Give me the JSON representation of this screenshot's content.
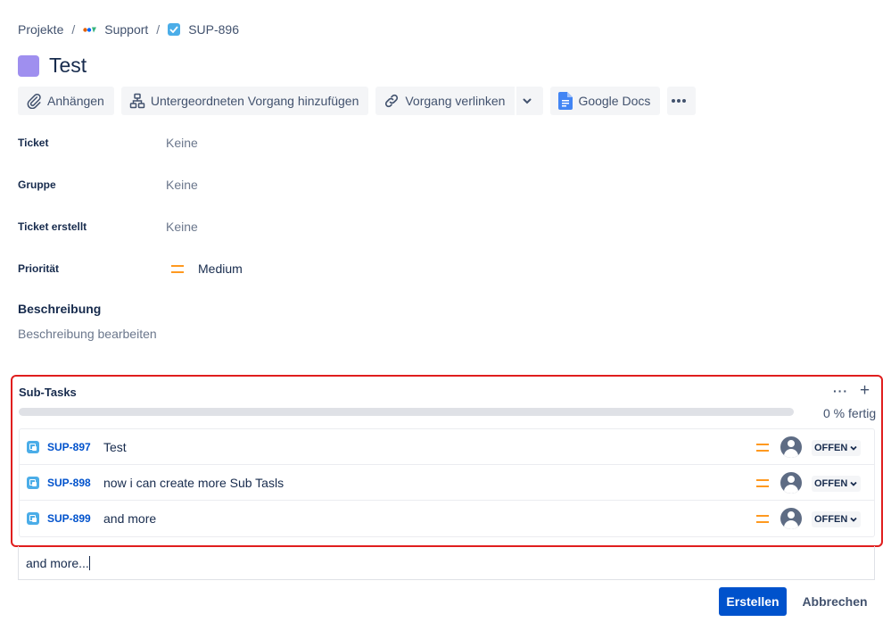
{
  "breadcrumb": {
    "projects": "Projekte",
    "separator": "/",
    "project": "Support",
    "issue_key": "SUP-896"
  },
  "issue": {
    "title": "Test",
    "type_icon_color": "#9f8fef"
  },
  "toolbar": {
    "attach": "Anhängen",
    "add_child": "Untergeordneten Vorgang hinzufügen",
    "link_issue": "Vorgang verlinken",
    "google_docs": "Google Docs"
  },
  "fields": [
    {
      "label": "Ticket",
      "value": "Keine"
    },
    {
      "label": "Gruppe",
      "value": "Keine"
    },
    {
      "label": "Ticket erstellt",
      "value": "Keine"
    },
    {
      "label": "Priorität",
      "value": "Medium"
    }
  ],
  "description": {
    "heading": "Beschreibung",
    "placeholder": "Beschreibung bearbeiten"
  },
  "subtasks": {
    "title": "Sub-Tasks",
    "progress_fraction": 0,
    "progress_text": "0 % fertig",
    "highlight_color": "#e01e1e",
    "items": [
      {
        "key": "SUP-897",
        "summary": "Test",
        "status": "OFFEN",
        "priority_icon": "medium-priority-icon"
      },
      {
        "key": "SUP-898",
        "summary": "now i can create more Sub Tasls",
        "status": "OFFEN",
        "priority_icon": "medium-priority-icon"
      },
      {
        "key": "SUP-899",
        "summary": "and more",
        "status": "OFFEN",
        "priority_icon": "medium-priority-icon"
      }
    ]
  },
  "new_subtask": {
    "value": "and more..."
  },
  "actions": {
    "create": "Erstellen",
    "cancel": "Abbrechen"
  },
  "colors": {
    "primary": "#0052cc",
    "priority_medium": "#ff991f",
    "subtask_icon": "#4bade8"
  }
}
